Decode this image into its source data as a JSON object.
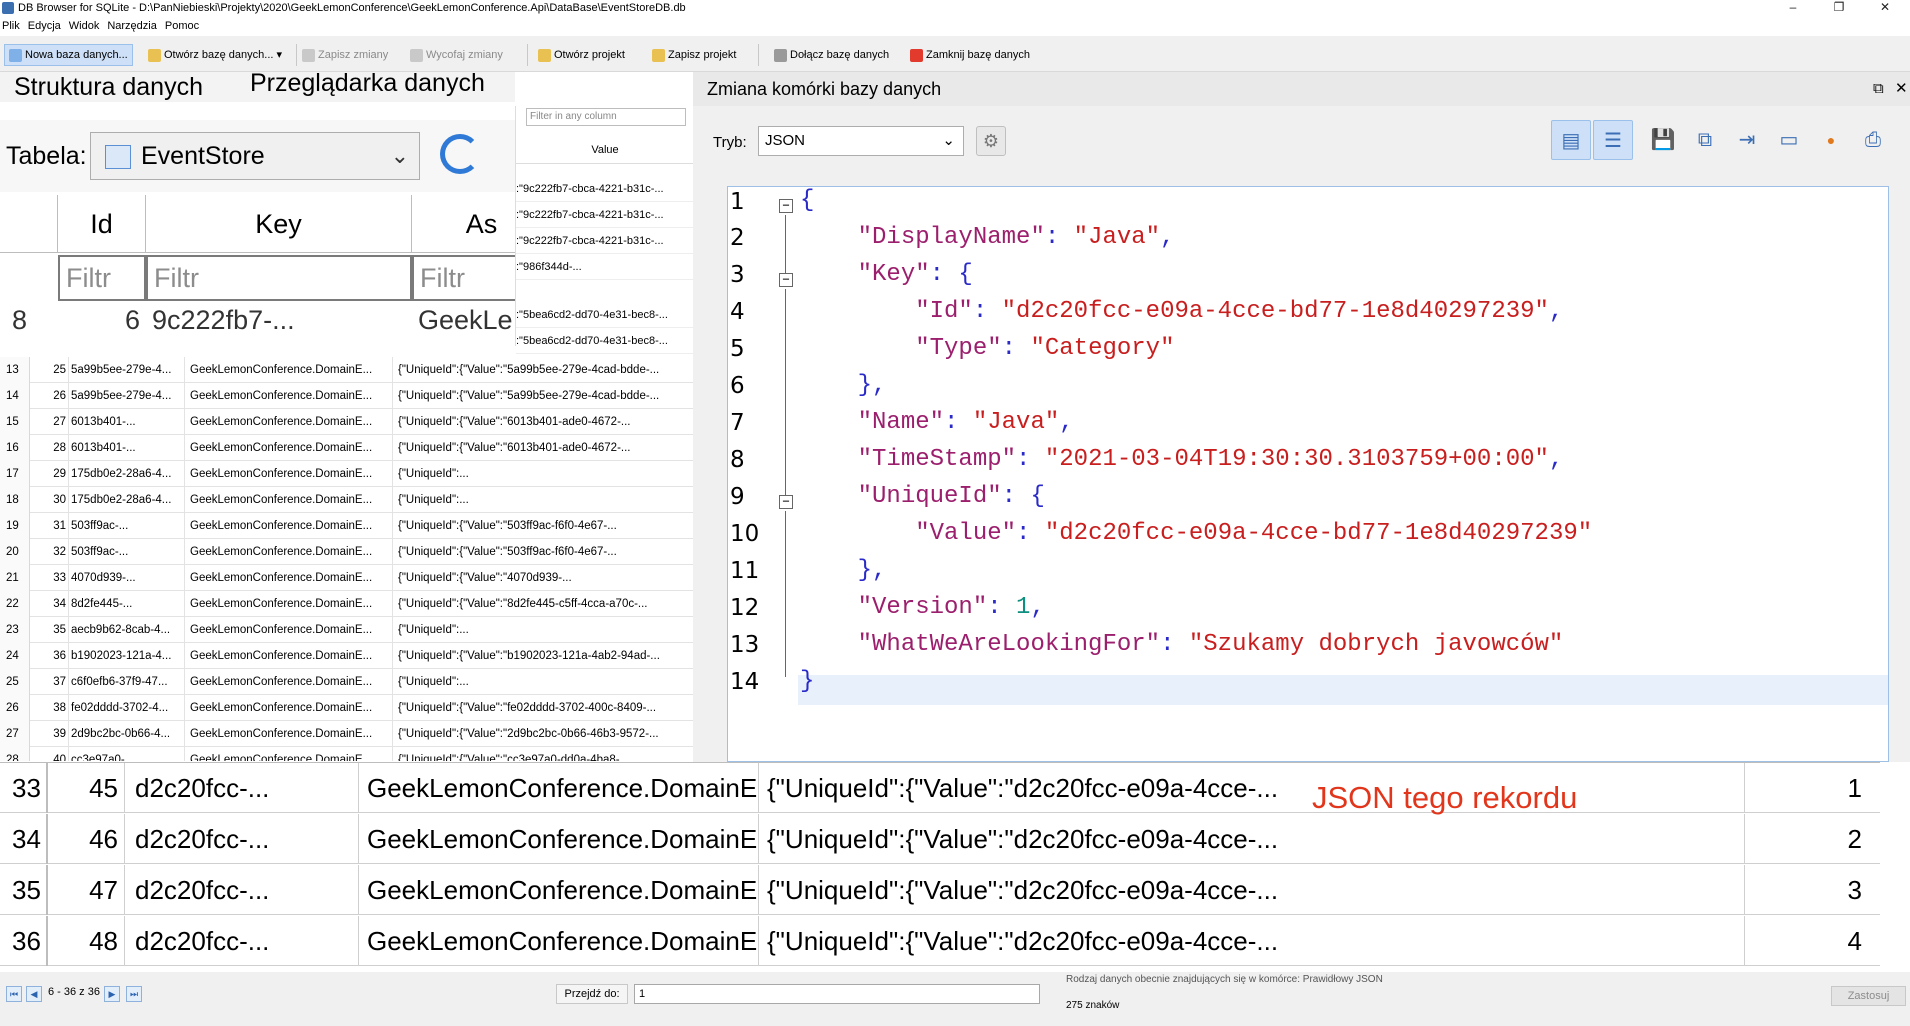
{
  "window": {
    "title": "DB Browser for SQLite - D:\\PanNiebieski\\Projekty\\2020\\GeekLemonConference\\GeekLemonConference.Api\\DataBase\\EventStoreDB.db",
    "minimize": "–",
    "maximize": "❐",
    "close": "✕"
  },
  "menu": [
    "Plik",
    "Edycja",
    "Widok",
    "Narzędzia",
    "Pomoc"
  ],
  "toolbar": {
    "new_db": "Nowa baza danych...",
    "open_db": "Otwórz bazę danych...",
    "open_db_arrow": "▾",
    "write": "Zapisz zmiany",
    "revert": "Wycofaj zmiany",
    "open_project": "Otwórz projekt",
    "save_project": "Zapisz projekt",
    "attach_db": "Dołącz bazę danych",
    "close_db": "Zamknij bazę danych"
  },
  "tabs": {
    "structure": "Struktura danych",
    "browse": "Przeglądarka danych"
  },
  "table_bar": {
    "label": "Tabela:",
    "selected": "EventStore",
    "chevron": "⌄"
  },
  "grid_zoom": {
    "headers": [
      "Id",
      "Key",
      "As"
    ],
    "filter_placeholder": "Filtr",
    "partial_row": {
      "rn": "8",
      "id": "6",
      "key": "9c222fb7-...",
      "agg": "GeekLe"
    }
  },
  "value_strip": {
    "filter_placeholder": "Filter in any column",
    "header": "Value",
    "rows": [
      ":\"9c222fb7-cbca-4221-b31c-...",
      ":\"9c222fb7-cbca-4221-b31c-...",
      ":\"9c222fb7-cbca-4221-b31c-...",
      ":\"986f344d-...",
      ":\"5bea6cd2-dd70-4e31-bec8-...",
      ":\"5bea6cd2-dd70-4e31-bec8-..."
    ]
  },
  "small_rows": [
    {
      "rn": "13",
      "id": "25",
      "key": "5a99b5ee-279e-4...",
      "agg": "GeekLemonConference.DomainE...",
      "data": "{\"UniqueId\":{\"Value\":\"5a99b5ee-279e-4cad-bdde-..."
    },
    {
      "rn": "14",
      "id": "26",
      "key": "5a99b5ee-279e-4...",
      "agg": "GeekLemonConference.DomainE...",
      "data": "{\"UniqueId\":{\"Value\":\"5a99b5ee-279e-4cad-bdde-..."
    },
    {
      "rn": "15",
      "id": "27",
      "key": "6013b401-...",
      "agg": "GeekLemonConference.DomainE...",
      "data": "{\"UniqueId\":{\"Value\":\"6013b401-ade0-4672-..."
    },
    {
      "rn": "16",
      "id": "28",
      "key": "6013b401-...",
      "agg": "GeekLemonConference.DomainE...",
      "data": "{\"UniqueId\":{\"Value\":\"6013b401-ade0-4672-..."
    },
    {
      "rn": "17",
      "id": "29",
      "key": "175db0e2-28a6-4...",
      "agg": "GeekLemonConference.DomainE...",
      "data": "{\"UniqueId\":..."
    },
    {
      "rn": "18",
      "id": "30",
      "key": "175db0e2-28a6-4...",
      "agg": "GeekLemonConference.DomainE...",
      "data": "{\"UniqueId\":..."
    },
    {
      "rn": "19",
      "id": "31",
      "key": "503ff9ac-...",
      "agg": "GeekLemonConference.DomainE...",
      "data": "{\"UniqueId\":{\"Value\":\"503ff9ac-f6f0-4e67-..."
    },
    {
      "rn": "20",
      "id": "32",
      "key": "503ff9ac-...",
      "agg": "GeekLemonConference.DomainE...",
      "data": "{\"UniqueId\":{\"Value\":\"503ff9ac-f6f0-4e67-..."
    },
    {
      "rn": "21",
      "id": "33",
      "key": "4070d939-...",
      "agg": "GeekLemonConference.DomainE...",
      "data": "{\"UniqueId\":{\"Value\":\"4070d939-..."
    },
    {
      "rn": "22",
      "id": "34",
      "key": "8d2fe445-...",
      "agg": "GeekLemonConference.DomainE...",
      "data": "{\"UniqueId\":{\"Value\":\"8d2fe445-c5ff-4cca-a70c-..."
    },
    {
      "rn": "23",
      "id": "35",
      "key": "aecb9b62-8cab-4...",
      "agg": "GeekLemonConference.DomainE...",
      "data": "{\"UniqueId\":..."
    },
    {
      "rn": "24",
      "id": "36",
      "key": "b1902023-121a-4...",
      "agg": "GeekLemonConference.DomainE...",
      "data": "{\"UniqueId\":{\"Value\":\"b1902023-121a-4ab2-94ad-..."
    },
    {
      "rn": "25",
      "id": "37",
      "key": "c6f0efb6-37f9-47...",
      "agg": "GeekLemonConference.DomainE...",
      "data": "{\"UniqueId\":..."
    },
    {
      "rn": "26",
      "id": "38",
      "key": "fe02dddd-3702-4...",
      "agg": "GeekLemonConference.DomainE...",
      "data": "{\"UniqueId\":{\"Value\":\"fe02dddd-3702-400c-8409-..."
    },
    {
      "rn": "27",
      "id": "39",
      "key": "2d9bc2bc-0b66-4...",
      "agg": "GeekLemonConference.DomainE...",
      "data": "{\"UniqueId\":{\"Value\":\"2d9bc2bc-0b66-46b3-9572-..."
    },
    {
      "rn": "28",
      "id": "40",
      "key": "cc3e97a0-...",
      "agg": "GeekLemonConference.DomainE...",
      "data": "{\"UniqueId\":{\"Value\":\"cc3e97a0-dd0a-4ba8-..."
    }
  ],
  "editor": {
    "title": "Zmiana komórki bazy danych",
    "float_icon": "⧉",
    "close_icon": "✕",
    "mode_label": "Tryb:",
    "mode_value": "JSON",
    "mode_chevron": "⌄",
    "gear": "⚙",
    "right_icons": [
      "▤",
      "☰",
      "💾",
      "⧉",
      "⇥",
      "▭",
      "●",
      "⎙"
    ],
    "line_numbers": [
      "1",
      "2",
      "3",
      "4",
      "5",
      "6",
      "7",
      "8",
      "9",
      "10",
      "11",
      "12",
      "13",
      "14"
    ],
    "fold_minus": "−",
    "json": {
      "open": "{",
      "DisplayName_k": "\"DisplayName\"",
      "DisplayName_v": "\"Java\"",
      "Key_k": "\"Key\"",
      "Id_k": "\"Id\"",
      "Id_v": "\"d2c20fcc-e09a-4cce-bd77-1e8d40297239\"",
      "Type_k": "\"Type\"",
      "Type_v": "\"Category\"",
      "Name_k": "\"Name\"",
      "Name_v": "\"Java\"",
      "TimeStamp_k": "\"TimeStamp\"",
      "TimeStamp_v": "\"2021-03-04T19:30:30.3103759+00:00\"",
      "UniqueId_k": "\"UniqueId\"",
      "Value_k": "\"Value\"",
      "Value_v": "\"d2c20fcc-e09a-4cce-bd77-1e8d40297239\"",
      "Version_k": "\"Version\"",
      "Version_v": "1",
      "What_k": "\"WhatWeAreLookingFor\"",
      "What_v": "\"Szukamy dobrych javowców\"",
      "close": "}"
    },
    "status_line1": "Rodzaj danych obecnie znajdujących się w komórce: Prawidłowy JSON",
    "status_line2": "275 znaków",
    "apply": "Zastosuj"
  },
  "big_rows": [
    {
      "rn": "33",
      "id": "45",
      "key": "d2c20fcc-...",
      "agg": "GeekLemonConference.DomainE...",
      "data": "{\"UniqueId\":{\"Value\":\"d2c20fcc-e09a-4cce-...",
      "ver": "1"
    },
    {
      "rn": "34",
      "id": "46",
      "key": "d2c20fcc-...",
      "agg": "GeekLemonConference.DomainE...",
      "data": "{\"UniqueId\":{\"Value\":\"d2c20fcc-e09a-4cce-...",
      "ver": "2"
    },
    {
      "rn": "35",
      "id": "47",
      "key": "d2c20fcc-...",
      "agg": "GeekLemonConference.DomainE...",
      "data": "{\"UniqueId\":{\"Value\":\"d2c20fcc-e09a-4cce-...",
      "ver": "3"
    },
    {
      "rn": "36",
      "id": "48",
      "key": "d2c20fcc-...",
      "agg": "GeekLemonConference.DomainE...",
      "data": "{\"UniqueId\":{\"Value\":\"d2c20fcc-e09a-4cce-...",
      "ver": "4"
    }
  ],
  "annotation": "JSON tego rekordu",
  "statusbar": {
    "first": "⏮",
    "prev": "◀",
    "next": "▶",
    "last": "⏭",
    "range": "6 - 36 z 36",
    "goto_label": "Przejdź do:",
    "goto_value": "1"
  },
  "colors": {
    "json_key": "#9b1f6d",
    "json_string": "#c81e1e",
    "json_number": "#0f8f80",
    "annotation": "#e2361c",
    "selection": "#cde0f7"
  }
}
